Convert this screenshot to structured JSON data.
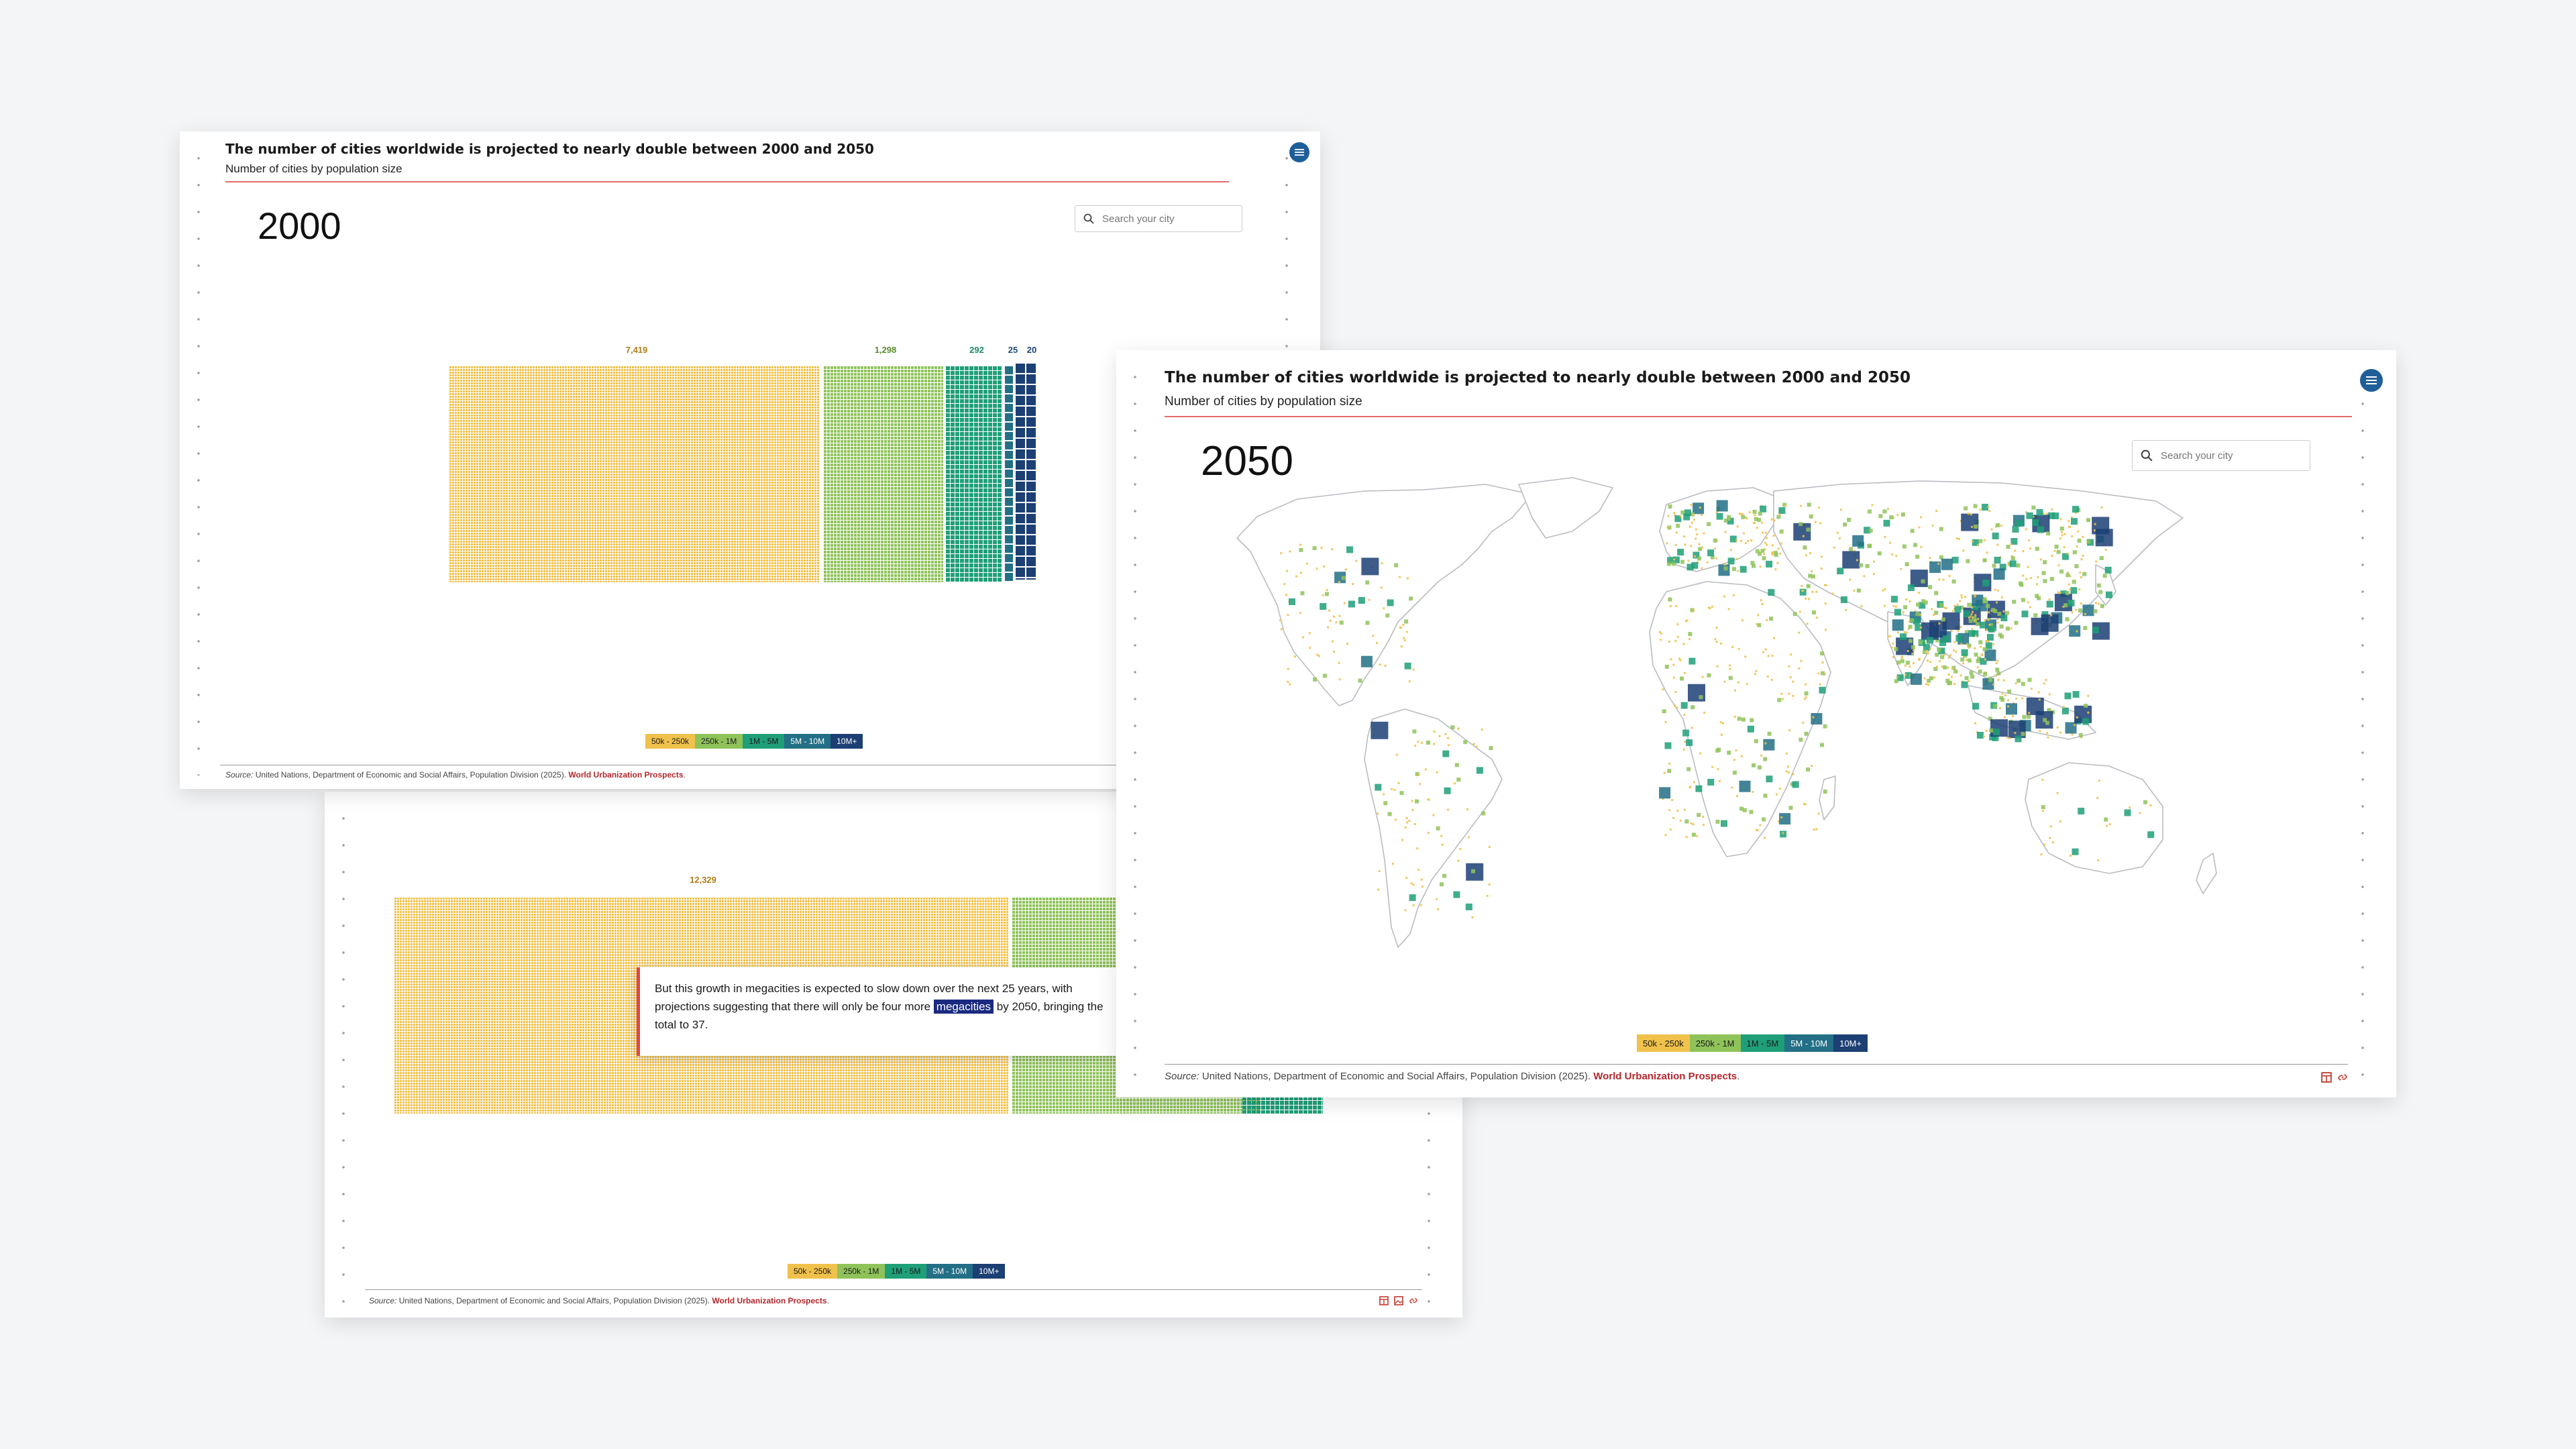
{
  "chart_title": "The number of cities worldwide is projected to nearly double between 2000 and 2050",
  "chart_subtitle": "Number of cities by population size",
  "search_placeholder": "Search your city",
  "legend_items": [
    "50k - 250k",
    "250k - 1M",
    "1M - 5M",
    "5M - 10M",
    "10M+"
  ],
  "colors": {
    "50k - 250k": "#f0c14b",
    "250k - 1M": "#8fc35a",
    "1M - 5M": "#1f9f78",
    "5M - 10M": "#226f86",
    "10M+": "#1c3f74",
    "accent_red": "#e26b6b",
    "source_link": "#b3272d"
  },
  "source": {
    "label": "Source:",
    "text": " United Nations, Department of Economic and Social Affairs, Population Division (2025). ",
    "link": "World Urbanization Prospects",
    "end": "."
  },
  "callout": {
    "before": "But this growth in megacities is expected to slow down over the next 25 years, with projections suggesting that there will only be four more ",
    "highlight": "megacities",
    "after": " by 2050, bringing the total to 37."
  },
  "chart_data": [
    {
      "type": "waffle",
      "year_label": "2000",
      "categories": [
        "50k - 250k",
        "250k - 1M",
        "1M - 5M",
        "5M - 10M",
        "10M+"
      ],
      "values": [
        7419,
        1298,
        292,
        25,
        20
      ],
      "value_labels": [
        "7,419",
        "1,298",
        "292",
        "25",
        "20"
      ]
    },
    {
      "type": "waffle",
      "categories": [
        "50k - 250k"
      ],
      "values": [
        12329
      ],
      "value_labels": [
        "12,329"
      ]
    },
    {
      "type": "map",
      "year_label": "2050",
      "categories": [
        "50k - 250k",
        "250k - 1M",
        "1M - 5M",
        "5M - 10M",
        "10M+"
      ]
    }
  ],
  "icons": [
    "menu-icon",
    "search-icon",
    "table-icon",
    "image-icon",
    "link-icon"
  ]
}
